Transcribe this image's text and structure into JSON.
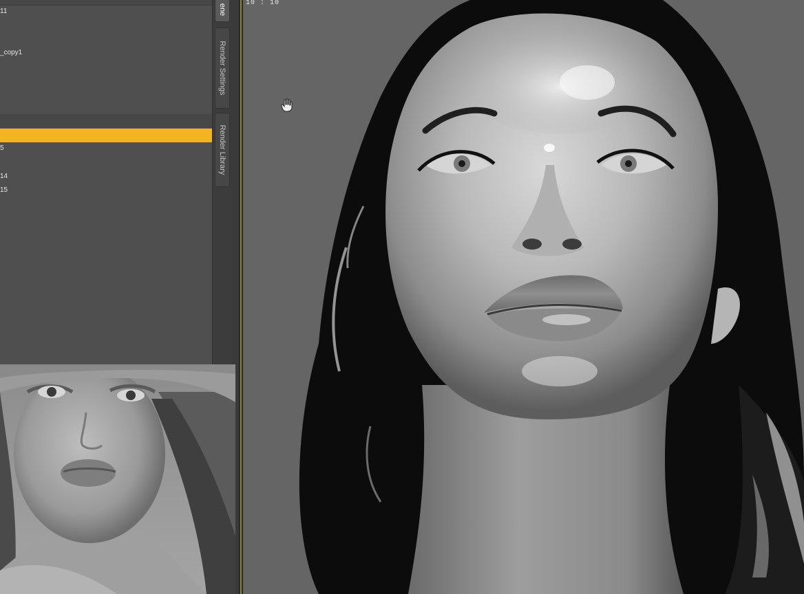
{
  "scene_panel": {
    "items": [
      {
        "label": "11"
      },
      {
        "label": "_copy1"
      },
      {
        "label": ""
      },
      {
        "label": "5"
      },
      {
        "label": "14"
      },
      {
        "label": "15"
      }
    ]
  },
  "tabs": [
    {
      "label": "ene",
      "active": true
    },
    {
      "label": "Render Settings",
      "active": false
    },
    {
      "label": "Render Library",
      "active": false
    }
  ],
  "viewport": {
    "timecode": "10 : 10"
  },
  "colors": {
    "selection": "#f2b51f",
    "panel": "#4f4f4f",
    "viewport_bg": "#656565"
  }
}
